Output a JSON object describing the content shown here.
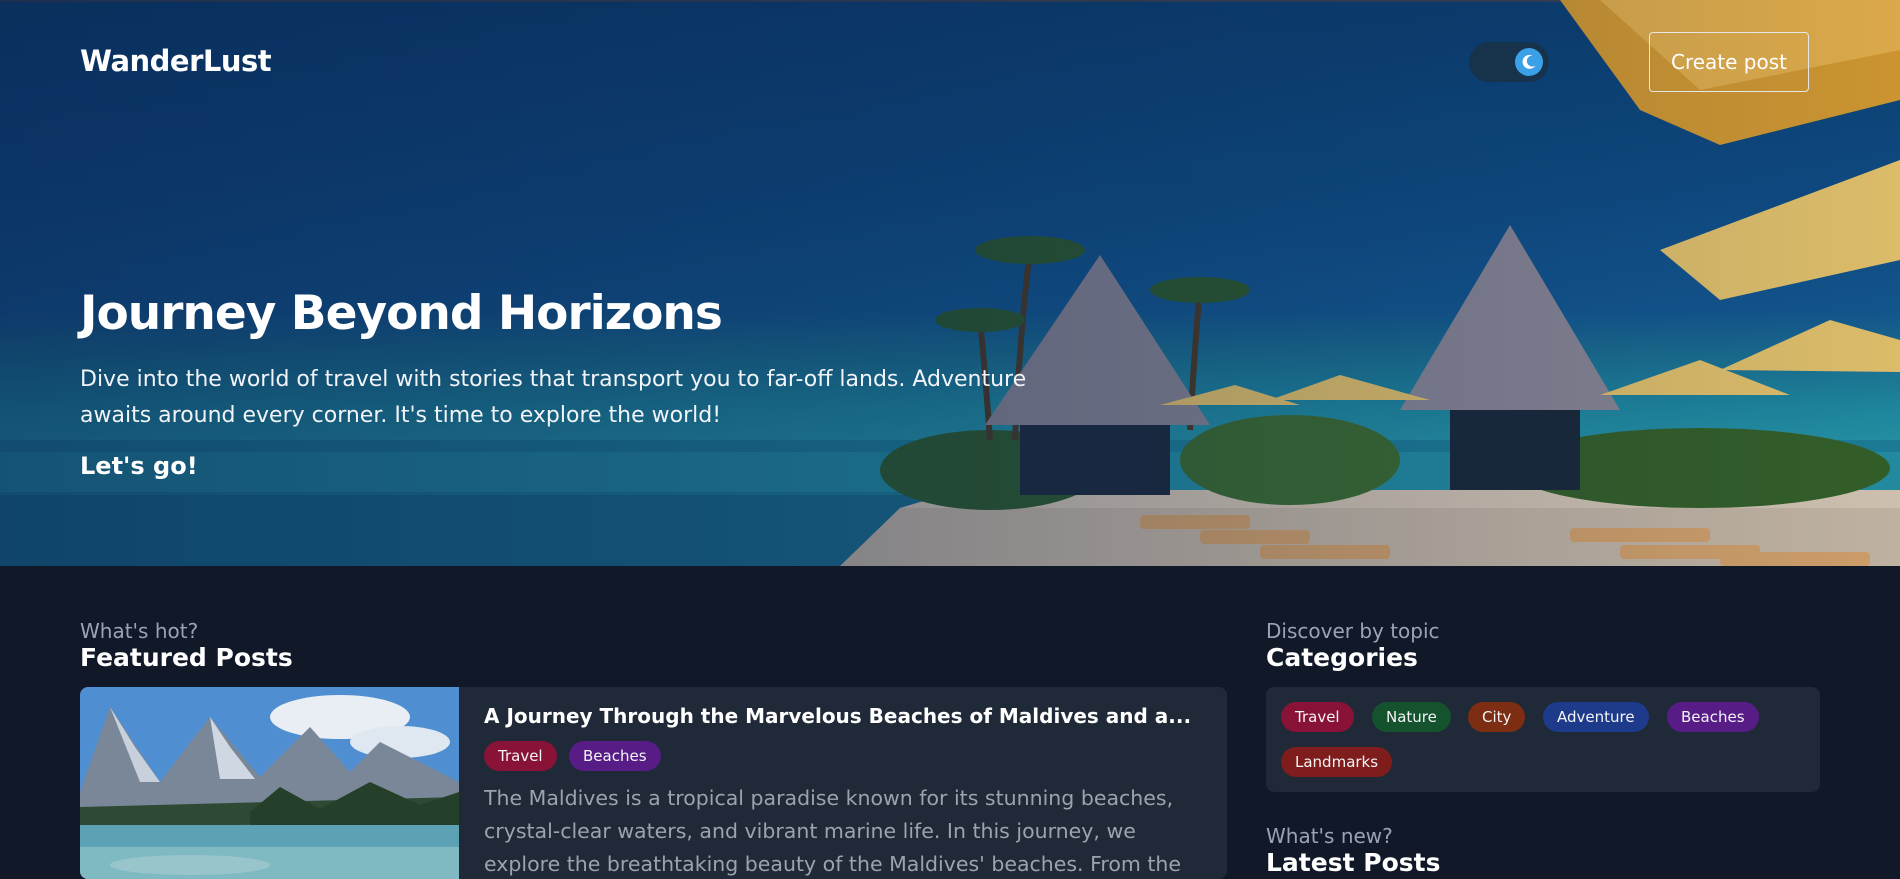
{
  "header": {
    "brand": "WanderLust",
    "theme_toggle_state": "dark",
    "create_button_label": "Create post"
  },
  "hero": {
    "title": "Journey Beyond Horizons",
    "text": "Dive into the world of travel with stories that transport you to far-off lands. Adventure awaits around every corner. It's time to explore the world!",
    "cta": "Let's go!"
  },
  "featured": {
    "kicker": "What's hot?",
    "title": "Featured Posts",
    "post": {
      "title": "A Journey Through the Marvelous Beaches of Maldives and a...",
      "tags": [
        {
          "label": "Travel",
          "color": "#881337"
        },
        {
          "label": "Beaches",
          "color": "#581c87"
        }
      ],
      "excerpt": "The Maldives is a tropical paradise known for its stunning beaches, crystal-clear waters, and vibrant marine life. In this journey, we explore the breathtaking beauty of the Maldives' beaches. From the white sand..."
    }
  },
  "categories": {
    "kicker": "Discover by topic",
    "title": "Categories",
    "items": [
      {
        "label": "Travel",
        "color": "#881337"
      },
      {
        "label": "Nature",
        "color": "#14532d"
      },
      {
        "label": "City",
        "color": "#7c2d12"
      },
      {
        "label": "Adventure",
        "color": "#1e3a8a"
      },
      {
        "label": "Beaches",
        "color": "#581c87"
      },
      {
        "label": "Landmarks",
        "color": "#7f1d1d"
      }
    ]
  },
  "latest": {
    "kicker": "What's new?",
    "title": "Latest Posts"
  },
  "colors": {
    "page_background": "#111827",
    "card_background": "#1f2937",
    "toggle_knob": "#3aa0e8"
  }
}
